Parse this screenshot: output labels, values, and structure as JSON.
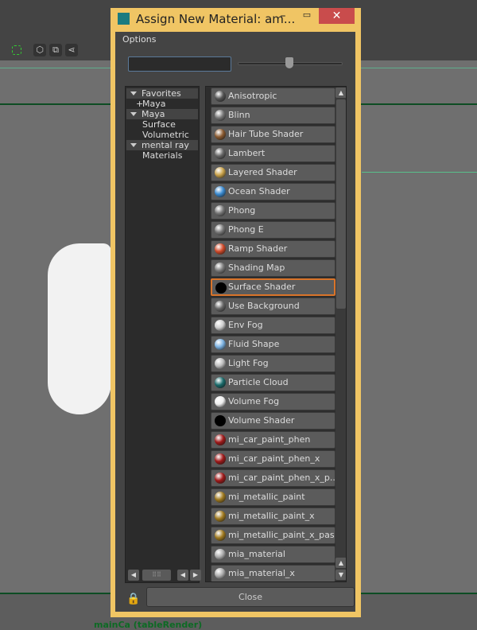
{
  "window": {
    "title": "Assign New Material: am...",
    "minimize": "–",
    "maximize": "▭",
    "close": "✕"
  },
  "menu": {
    "options": "Options"
  },
  "search": {
    "value": "",
    "placeholder": ""
  },
  "slider": {
    "value_percent": 49
  },
  "tree": [
    {
      "label": "Favorites",
      "type": "header"
    },
    {
      "label": "Maya",
      "type": "item",
      "prefix": "+"
    },
    {
      "label": "Maya",
      "type": "header"
    },
    {
      "label": "Surface",
      "type": "item"
    },
    {
      "label": "Volumetric",
      "type": "item"
    },
    {
      "label": "mental ray",
      "type": "header"
    },
    {
      "label": "Materials",
      "type": "item"
    }
  ],
  "materials": [
    {
      "label": "Anisotropic",
      "color": "#555"
    },
    {
      "label": "Blinn",
      "color": "#777"
    },
    {
      "label": "Hair Tube Shader",
      "color": "#8a5a30"
    },
    {
      "label": "Lambert",
      "color": "#666"
    },
    {
      "label": "Layered Shader",
      "color": "#c9a24a"
    },
    {
      "label": "Ocean Shader",
      "color": "#3a8ad0"
    },
    {
      "label": "Phong",
      "color": "#777"
    },
    {
      "label": "Phong E",
      "color": "#777"
    },
    {
      "label": "Ramp Shader",
      "color": "#d04a2a"
    },
    {
      "label": "Shading Map",
      "color": "#7a7a7a"
    },
    {
      "label": "Surface Shader",
      "color": "#000",
      "selected": true
    },
    {
      "label": "Use Background",
      "color": "#666"
    },
    {
      "label": "Env Fog",
      "color": "#ccc"
    },
    {
      "label": "Fluid Shape",
      "color": "#7ab0e0"
    },
    {
      "label": "Light Fog",
      "color": "#bbb"
    },
    {
      "label": "Particle Cloud",
      "color": "#1a6a6a"
    },
    {
      "label": "Volume Fog",
      "color": "#eee"
    },
    {
      "label": "Volume Shader",
      "color": "#000"
    },
    {
      "label": "mi_car_paint_phen",
      "color": "#a01a1a"
    },
    {
      "label": "mi_car_paint_phen_x",
      "color": "#a01a1a"
    },
    {
      "label": "mi_car_paint_phen_x_p...",
      "color": "#a01a1a"
    },
    {
      "label": "mi_metallic_paint",
      "color": "#a07a20"
    },
    {
      "label": "mi_metallic_paint_x",
      "color": "#a07a20"
    },
    {
      "label": "mi_metallic_paint_x_pas...",
      "color": "#a07a20"
    },
    {
      "label": "mia_material",
      "color": "#aaa"
    },
    {
      "label": "mia_material_x",
      "color": "#aaa"
    }
  ],
  "buttons": {
    "close": "Close"
  },
  "background": {
    "panel_label": "mainCa (tableRender)"
  }
}
